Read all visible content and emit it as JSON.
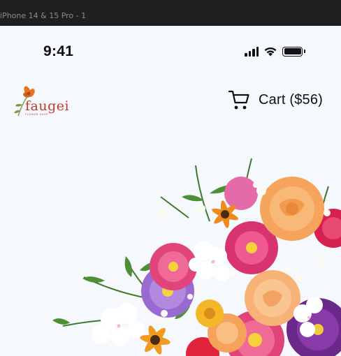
{
  "frame": {
    "label": "iPhone 14 & 15 Pro - 1"
  },
  "status_bar": {
    "time": "9:41"
  },
  "brand": {
    "name": "faugei",
    "tagline": "FLOWER SHOP"
  },
  "header": {
    "cart_label": "Cart ($56)"
  },
  "icons": [
    "signal-icon",
    "wifi-icon",
    "battery-icon",
    "cart-icon"
  ],
  "colors": {
    "background": "#f5f8fd",
    "brand": "#c0392b",
    "accent_orange": "#e8731f"
  }
}
